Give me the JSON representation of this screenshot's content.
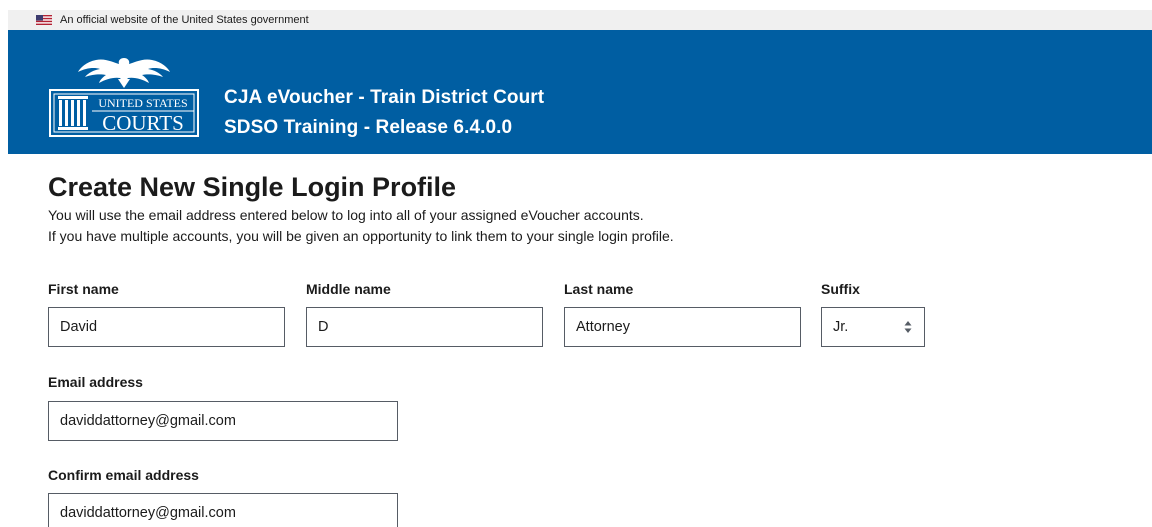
{
  "gov_banner": {
    "text": "An official website of the United States government"
  },
  "header": {
    "logo_text": [
      "UNITED STATES",
      "COURTS"
    ],
    "title_line1": "CJA eVoucher - Train District Court",
    "title_line2": "SDSO Training - Release 6.4.0.0",
    "background_color": "#005ea2"
  },
  "page": {
    "title": "Create New Single Login Profile",
    "intro_line1": "You will use the email address entered below to log into all of your assigned eVoucher accounts.",
    "intro_line2": "If you have multiple accounts, you will be given an opportunity to link them to your single login profile."
  },
  "form": {
    "first_name": {
      "label": "First name",
      "value": "David"
    },
    "middle_name": {
      "label": "Middle name",
      "value": "D"
    },
    "last_name": {
      "label": "Last name",
      "value": "Attorney"
    },
    "suffix": {
      "label": "Suffix",
      "value": "Jr.",
      "icon": "up-down-caret-icon"
    },
    "email": {
      "label": "Email address",
      "value": "daviddattorney@gmail.com"
    },
    "confirm_email": {
      "label": "Confirm email address",
      "value": "daviddattorney@gmail.com"
    }
  }
}
